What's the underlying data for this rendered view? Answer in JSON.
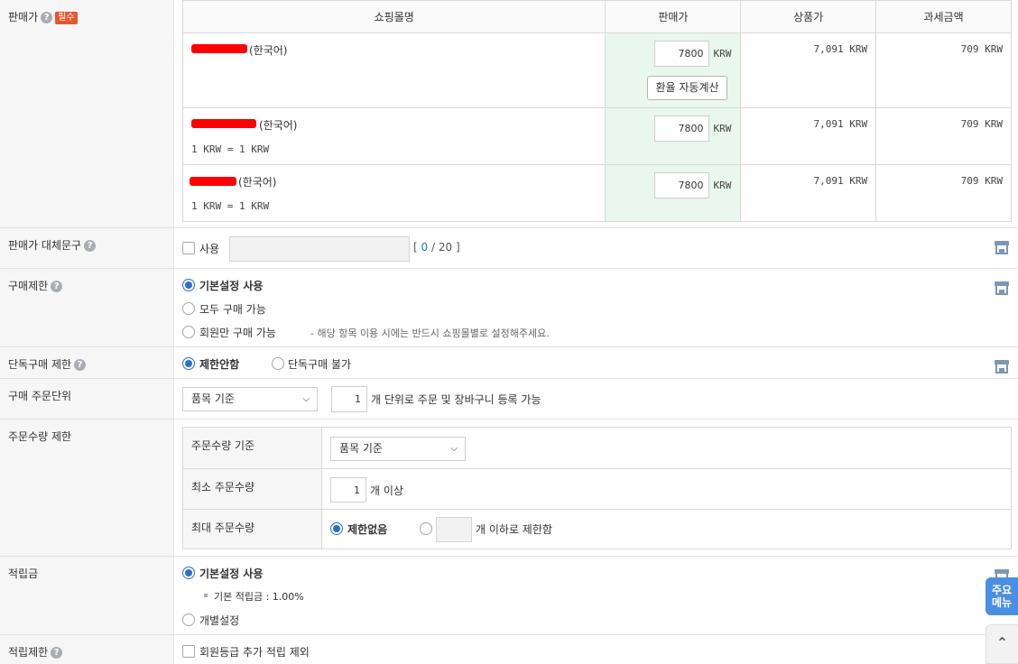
{
  "price": {
    "label": "판매가",
    "required_badge": "필수",
    "columns": [
      "쇼핑몰명",
      "판매가",
      "상품가",
      "과세금액"
    ],
    "rows": [
      {
        "lang": "(한국어)",
        "price_value": "7800",
        "currency": "KRW",
        "goods_price": "7,091 KRW",
        "tax": "709 KRW",
        "button": "환율 자동계산",
        "rate": ""
      },
      {
        "lang": "(한국어)",
        "price_value": "7800",
        "currency": "KRW",
        "goods_price": "7,091 KRW",
        "tax": "709 KRW",
        "button": "",
        "rate": "1 KRW = 1 KRW"
      },
      {
        "lang": "(한국어)",
        "price_value": "7800",
        "currency": "KRW",
        "goods_price": "7,091 KRW",
        "tax": "709 KRW",
        "button": "",
        "rate": "1 KRW = 1 KRW"
      }
    ]
  },
  "price_alt": {
    "label": "판매가 대체문구",
    "use_label": "사용",
    "counter_open": "[",
    "count": "0",
    "count_sep": "/ 20",
    "counter_close": "]"
  },
  "purchase_limit": {
    "label": "구매제한",
    "opt1": "기본설정 사용",
    "opt2": "모두 구매 가능",
    "opt3": "회원만 구매 가능",
    "note": "- 해당 항목 이용 시에는 반드시 쇼핑몰별로 설정해주세요."
  },
  "single_purchase": {
    "label": "단독구매 제한",
    "opt1": "제한안함",
    "opt2": "단독구매 불가"
  },
  "order_unit": {
    "label": "구매 주문단위",
    "select": "품목 기준",
    "qty": "1",
    "text": "개 단위로 주문 및 장바구니 등록 가능"
  },
  "order_qty": {
    "label": "주문수량 제한",
    "basis_label": "주문수량 기준",
    "basis_select": "품목 기준",
    "min_label": "최소 주문수량",
    "min_value": "1",
    "min_suffix": "개 이상",
    "max_label": "최대 주문수량",
    "max_opt1": "제한없음",
    "max_suffix": "개 이하로 제한함"
  },
  "points": {
    "label": "적립금",
    "opt1": "기본설정 사용",
    "default_rate": "기본 적립금 : 1.00%",
    "opt2": "개별설정"
  },
  "points_limit": {
    "label": "적립제한",
    "option": "회원등급 추가 적립 제외"
  },
  "side": {
    "menu": "주요\n메뉴",
    "menu_top": "주요",
    "menu_bottom": "메뉴"
  }
}
